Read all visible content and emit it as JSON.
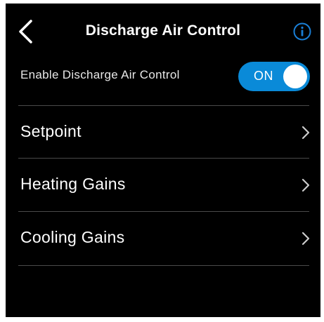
{
  "header": {
    "title": "Discharge Air Control",
    "back_icon": "chevron-left-icon",
    "info_icon": "info-icon"
  },
  "enable": {
    "label": "Enable Discharge Air Control",
    "toggle_state": "ON",
    "toggle_color": "#0a8ad8"
  },
  "menu": {
    "items": [
      {
        "label": "Setpoint",
        "icon": "chevron-right-icon"
      },
      {
        "label": "Heating Gains",
        "icon": "chevron-right-icon"
      },
      {
        "label": "Cooling Gains",
        "icon": "chevron-right-icon"
      }
    ]
  },
  "colors": {
    "background": "#000000",
    "text": "#ffffff",
    "accent": "#1a7fd6",
    "divider": "#4a4a4a"
  }
}
